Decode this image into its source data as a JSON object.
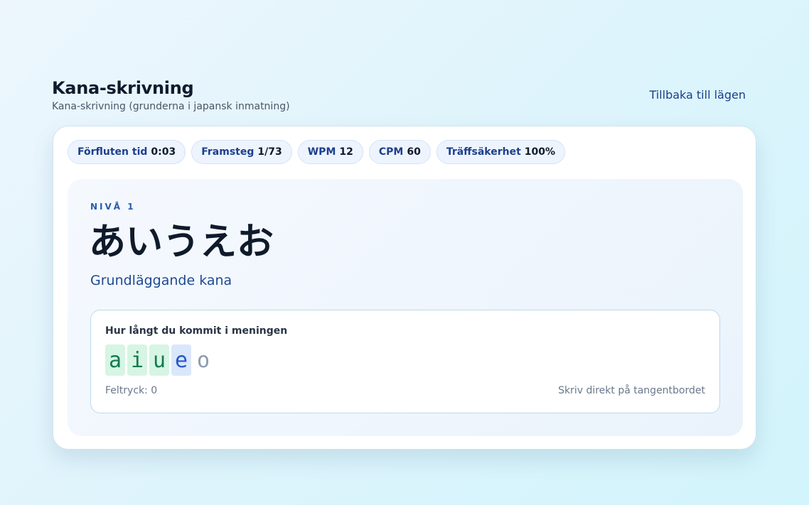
{
  "header": {
    "title": "Kana-skrivning",
    "subtitle": "Kana-skrivning (grunderna i japansk inmatning)",
    "back_label": "Tillbaka till lägen"
  },
  "stats": {
    "elapsed": {
      "label": "Förfluten tid",
      "value": "0:03"
    },
    "progress": {
      "label": "Framsteg",
      "value": "1/73"
    },
    "wpm": {
      "label": "WPM",
      "value": "12"
    },
    "cpm": {
      "label": "CPM",
      "value": "60"
    },
    "accuracy": {
      "label": "Träffsäkerhet",
      "value": "100%"
    }
  },
  "stage": {
    "level_label": "NIVÅ 1",
    "kana": "あいうえお",
    "description": "Grundläggande kana"
  },
  "progress_box": {
    "label": "Hur långt du kommit i meningen",
    "chars": [
      {
        "char": "a",
        "state": "done"
      },
      {
        "char": "i",
        "state": "done"
      },
      {
        "char": "u",
        "state": "done"
      },
      {
        "char": "e",
        "state": "current"
      },
      {
        "char": "o",
        "state": "todo"
      }
    ],
    "errors": "Feltryck: 0",
    "hint": "Skriv direkt på tangentbordet"
  },
  "colors": {
    "accent": "#1a3f8a",
    "done_bg": "#d6f5e4",
    "done_text": "#157a50",
    "current_bg": "#dae7fa",
    "current_text": "#2557c6",
    "todo_text": "#8d9bb0"
  }
}
